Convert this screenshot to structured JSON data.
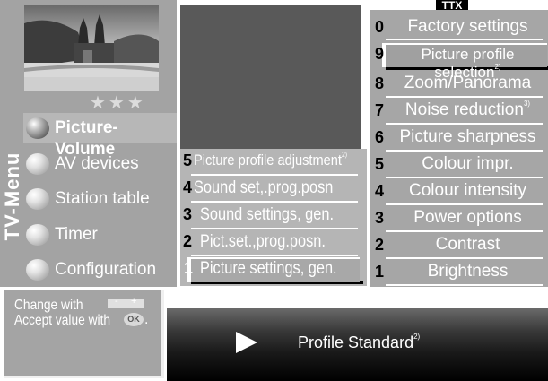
{
  "window": {
    "badge": "TTX",
    "vertical_title": "TV-Menu"
  },
  "rating": "★★★",
  "left_menu": [
    {
      "label": "Picture-Volume",
      "active": true
    },
    {
      "label": "AV devices"
    },
    {
      "label": "Station table"
    },
    {
      "label": "Timer"
    },
    {
      "label": "Configuration"
    }
  ],
  "help": {
    "line1": "Change with",
    "line2": "Accept value with",
    "minus": "-",
    "plus": "+",
    "ok": "OK",
    "period": "."
  },
  "mid_list": [
    {
      "num": "5",
      "label": "Picture profile adjustment",
      "sup": "2)"
    },
    {
      "num": "4",
      "label": "Sound set,.prog.posn"
    },
    {
      "num": "3",
      "label": "Sound settings, gen."
    },
    {
      "num": "2",
      "label": "Pict.set.,prog.posn."
    },
    {
      "num": "1",
      "label": "Picture settings, gen.",
      "selected": true
    }
  ],
  "right_list": [
    {
      "num": "0",
      "label": "Factory settings"
    },
    {
      "num": "9",
      "label": "Picture profile selection",
      "sup": "2)",
      "selected": true
    },
    {
      "num": "8",
      "label": "Zoom/Panorama"
    },
    {
      "num": "7",
      "label": "Noise reduction",
      "sup": "3)"
    },
    {
      "num": "6",
      "label": "Picture sharpness"
    },
    {
      "num": "5",
      "label": "Colour impr."
    },
    {
      "num": "4",
      "label": "Colour intensity"
    },
    {
      "num": "3",
      "label": "Power options"
    },
    {
      "num": "2",
      "label": "Contrast"
    },
    {
      "num": "1",
      "label": "Brightness"
    }
  ],
  "info": {
    "text": "Profile Standard",
    "sup": "2)",
    "icon": "play-icon"
  },
  "colors": {
    "panel": "#a3a3a3",
    "highlight": "#ffffff",
    "video": "#595959"
  }
}
